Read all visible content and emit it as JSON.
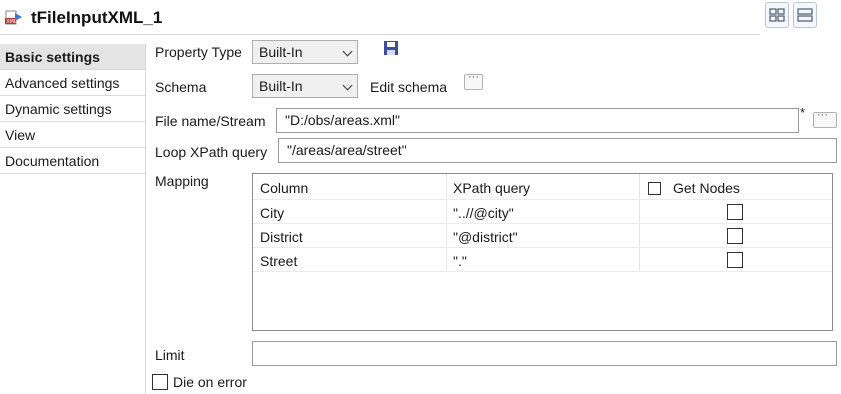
{
  "header": {
    "title": "tFileInputXML_1",
    "icon": "xml-component-icon",
    "view_buttons": [
      "grid-view-icon",
      "list-view-icon"
    ]
  },
  "sidebar": {
    "items": [
      {
        "label": "Basic settings",
        "active": true
      },
      {
        "label": "Advanced settings",
        "active": false
      },
      {
        "label": "Dynamic settings",
        "active": false
      },
      {
        "label": "View",
        "active": false
      },
      {
        "label": "Documentation",
        "active": false
      }
    ]
  },
  "form": {
    "property_type_label": "Property Type",
    "property_type_value": "Built-In",
    "schema_label": "Schema",
    "schema_value": "Built-In",
    "edit_schema_label": "Edit schema",
    "filename_label": "File name/Stream",
    "filename_value": "\"D:/obs/areas.xml\"",
    "filename_asterisk": "*",
    "loop_label": "Loop XPath query",
    "loop_value": "\"/areas/area/street\"",
    "mapping_label": "Mapping",
    "limit_label": "Limit",
    "limit_value": "",
    "die_on_error_label": "Die on error"
  },
  "mapping": {
    "headers": {
      "column": "Column",
      "xpath": "XPath query",
      "get_nodes": "Get Nodes"
    },
    "rows": [
      {
        "column": "City",
        "xpath": "\"..//@city\"",
        "get_nodes": false
      },
      {
        "column": "District",
        "xpath": "\"@district\"",
        "get_nodes": false
      },
      {
        "column": "Street",
        "xpath": "\".\"",
        "get_nodes": false
      }
    ]
  },
  "colors": {
    "save_icon": "#3b4fa0",
    "active_nav": "#e4e4e4"
  }
}
